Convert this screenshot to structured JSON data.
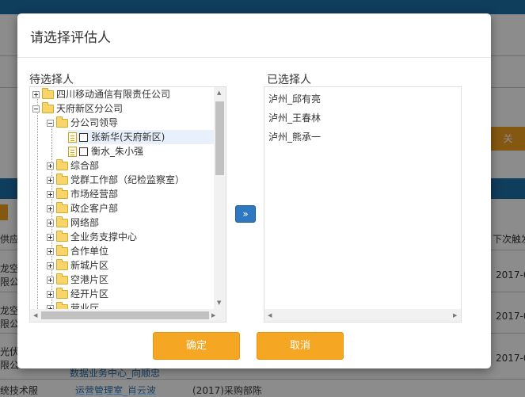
{
  "background": {
    "header_cells": [
      "供应",
      "下次触发"
    ],
    "rows": [
      {
        "left": "龙空",
        "left2": "限公",
        "date": "2017-0"
      },
      {
        "left": "龙空",
        "left2": "限公",
        "date": "2017-0"
      },
      {
        "left": "光伏",
        "left2": "限公",
        "date": "2017-0"
      }
    ],
    "button_label": "关",
    "bottom_row": [
      "统技术服",
      "运营管理室_肖云波",
      "(2017)采购部陈"
    ],
    "bottom_partial": "数据业务中心_向顺忠"
  },
  "dialog": {
    "title": "请选择评估人",
    "left_label": "待选择人",
    "right_label": "已选择人",
    "move_button": "»",
    "ok_label": "确定",
    "cancel_label": "取消"
  },
  "tree": {
    "n0": "四川移动通信有限责任公司",
    "n1": "天府新区分公司",
    "n2": "分公司领导",
    "n3": "张新华(天府新区)",
    "n4": "衡水_朱小强",
    "n5": "综合部",
    "n6": "党群工作部（纪检监察室）",
    "n7": "市场经营部",
    "n8": "政企客户部",
    "n9": "网络部",
    "n10": "全业务支撑中心",
    "n11": "合作单位",
    "n12": "新城片区",
    "n13": "空港片区",
    "n14": "经开片区",
    "n15": "营业厅"
  },
  "selected": [
    "泸州_邱有亮",
    "泸州_王春林",
    "泸州_熊承一"
  ]
}
